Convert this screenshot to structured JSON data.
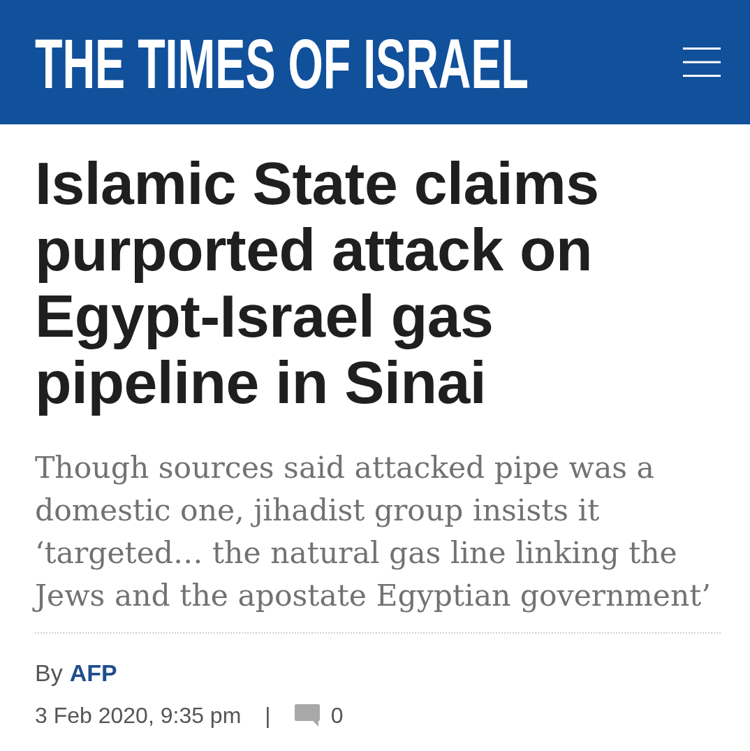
{
  "header": {
    "logo": "THE TIMES OF ISRAEL"
  },
  "article": {
    "headline": "Islamic State claims purported attack on Egypt-Israel gas pipeline in Sinai",
    "subtitle": "Though sources said attacked pipe was a domestic one, jihadist group insists it ‘targeted… the natural gas line linking the Jews and the apostate Egyptian government’",
    "byline": {
      "prefix": "By",
      "author": "AFP"
    },
    "meta": {
      "date": "3 Feb 2020, 9:35 pm",
      "separator": "|",
      "comment_count": "0"
    }
  }
}
